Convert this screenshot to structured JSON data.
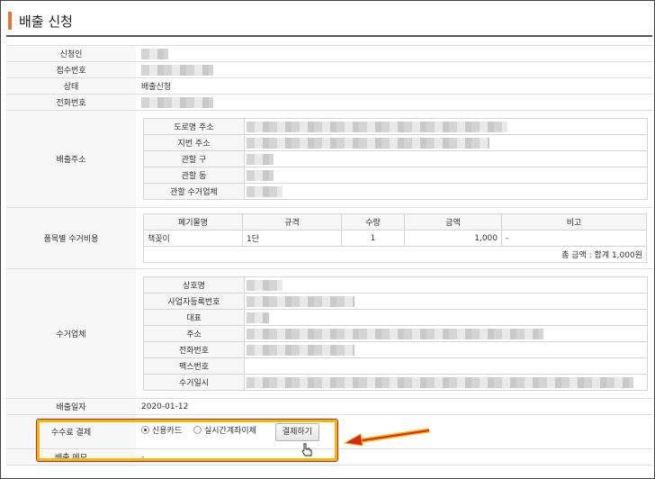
{
  "page": {
    "title": "배출 신청"
  },
  "rows": {
    "applicant_label": "신청인",
    "receipt_no_label": "접수번호",
    "status_label": "상태",
    "status_value": "배출신청",
    "phone_label": "전화번호",
    "address_label": "배출주소",
    "items_label": "품목별 수거비용",
    "collector_label": "수거업체",
    "date_label": "배출일자",
    "date_value": "2020-01-12",
    "fee_label": "수수료 결제",
    "memo_label": "배출 메모",
    "memo_value": "-"
  },
  "address": {
    "road_label": "도로명 주소",
    "lot_label": "지번 주소",
    "district_label": "관할 구",
    "dong_label": "관할 동",
    "collector_label": "관할 수거업체"
  },
  "items_table": {
    "headers": [
      "폐기물명",
      "규격",
      "수량",
      "금액",
      "비고"
    ],
    "row": {
      "name": "책꽂이",
      "spec": "1단",
      "qty": "1",
      "amount": "1,000",
      "note": "-"
    },
    "total": "총 금액 : 합계 1,000원"
  },
  "collector": {
    "name_label": "상호명",
    "biz_no_label": "사업자등록번호",
    "rep_label": "대표",
    "address_label": "주소",
    "phone_label": "전화번호",
    "fax_label": "팩스번호",
    "collect_date_label": "수거일시"
  },
  "payment": {
    "option_card": "신용카드",
    "option_transfer": "실시간계좌이체",
    "selected": "신용카드",
    "pay_button": "결제하기"
  },
  "colors": {
    "accent": "#e8742f",
    "highlight": "#f1b806",
    "arrow": "#d7281e"
  }
}
